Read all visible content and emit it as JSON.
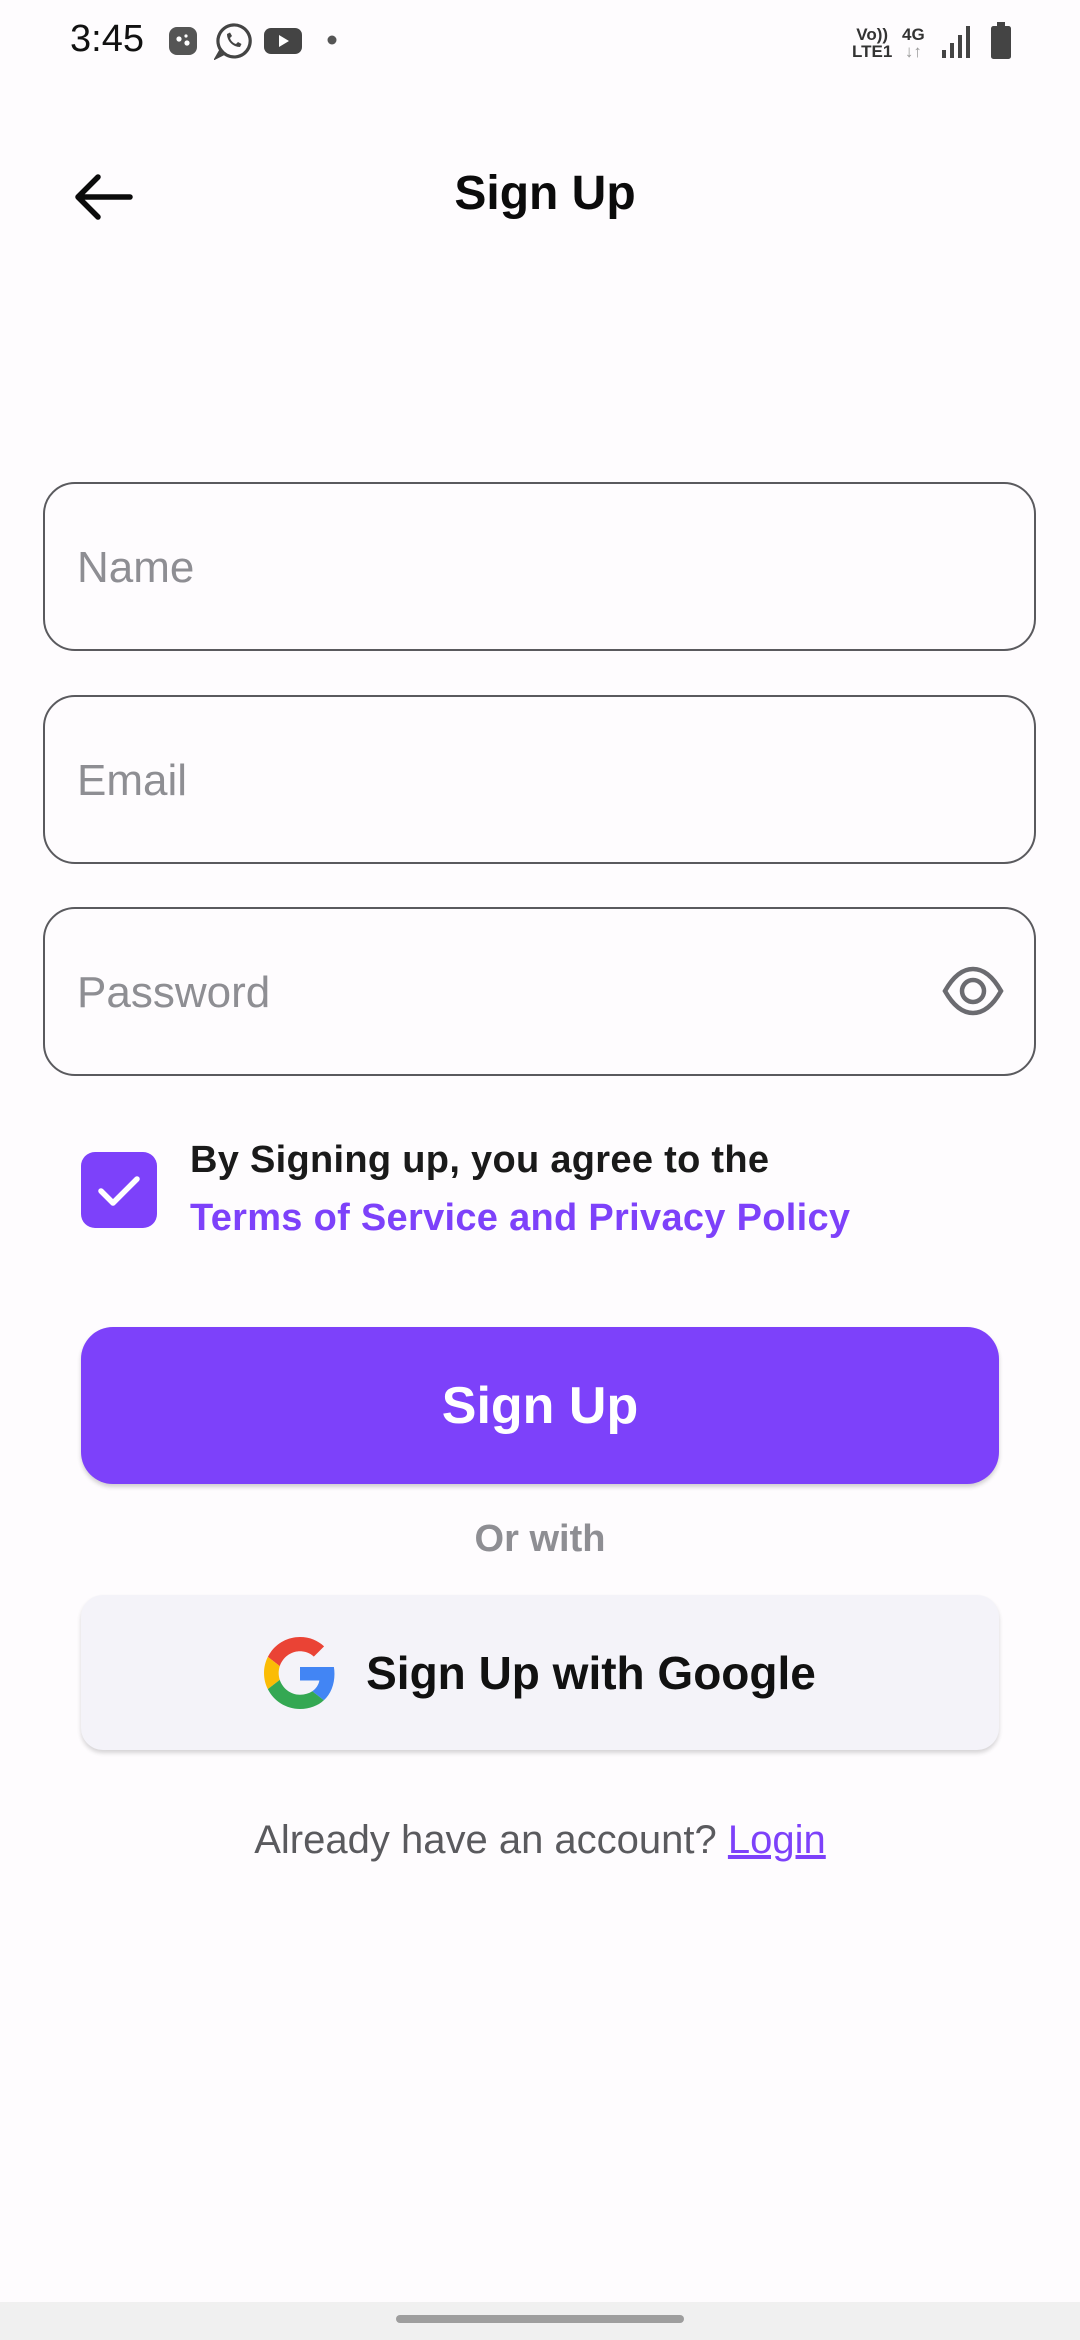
{
  "status_bar": {
    "time": "3:45",
    "left_icons": [
      "game-icon",
      "whatsapp-icon",
      "youtube-icon",
      "dot-icon"
    ],
    "volte_top": "Vo))",
    "volte_bottom": "LTE1",
    "network": "4G",
    "right_icons": [
      "signal-icon",
      "battery-icon"
    ]
  },
  "header": {
    "title": "Sign Up",
    "back_icon": "arrow-left-icon"
  },
  "form": {
    "name_placeholder": "Name",
    "email_placeholder": "Email",
    "password_placeholder": "Password",
    "password_icon": "eye-icon"
  },
  "terms": {
    "checked": true,
    "line1": "By Signing up, you agree to the",
    "link": "Terms of Service and Privacy Policy"
  },
  "buttons": {
    "sign_up": "Sign Up",
    "or_with": "Or with",
    "google": "Sign Up with Google"
  },
  "footer": {
    "prompt": "Already have an account? ",
    "login": "Login"
  },
  "colors": {
    "accent": "#7d41fa",
    "background": "#fefcfe",
    "google_button_bg": "#f4f3f9",
    "border": "#5a5a5e",
    "muted": "#8e8e93"
  }
}
